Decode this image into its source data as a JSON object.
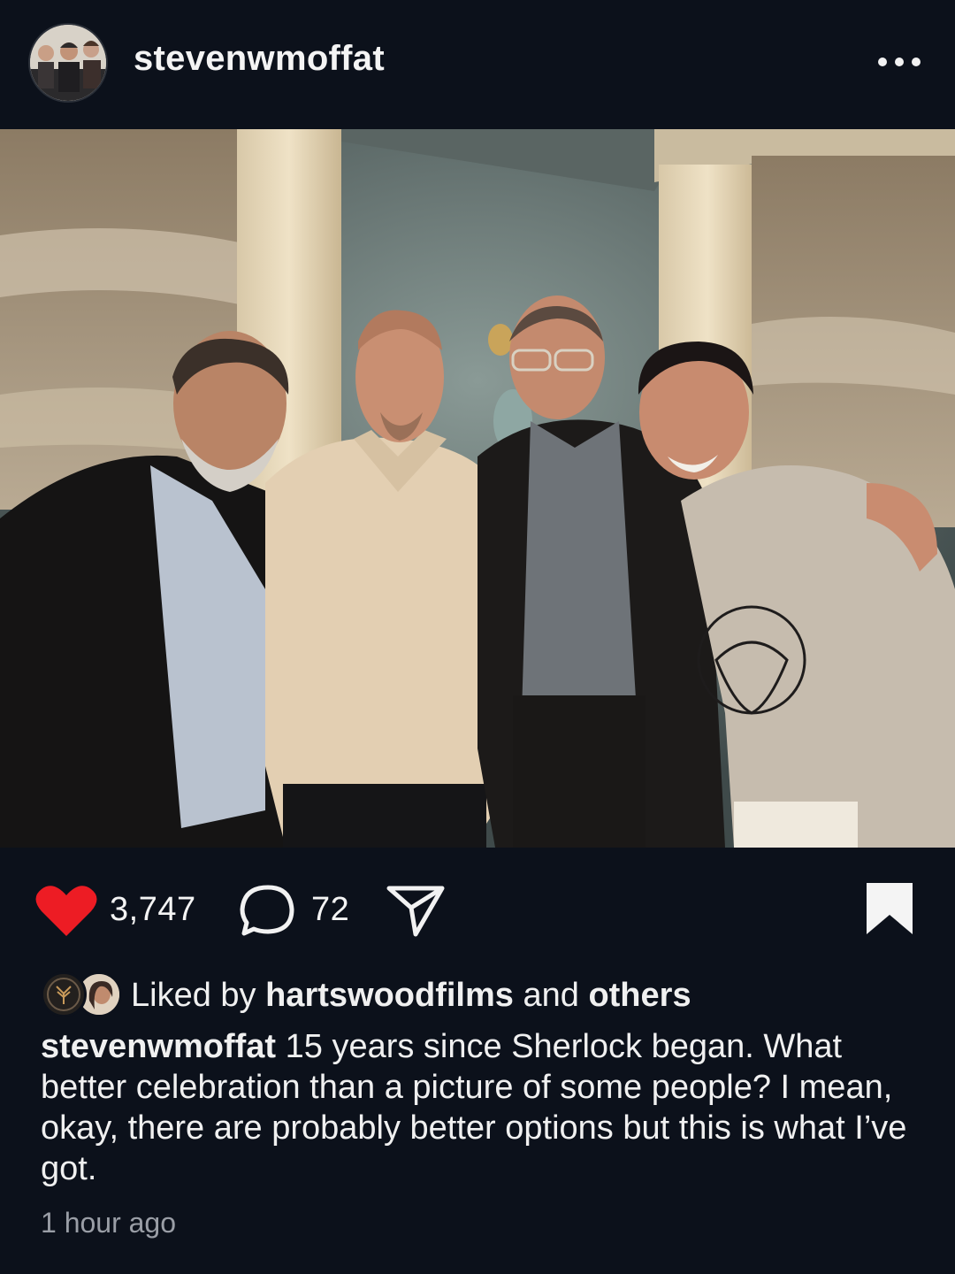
{
  "post": {
    "username": "stevenwmoffat",
    "more_icon": "more-dots-icon",
    "likes_count": "3,747",
    "comments_count": "72",
    "liked_by_prefix": "Liked by ",
    "liked_by_user": "hartswoodfilms",
    "liked_by_joiner": " and ",
    "liked_by_others": "others",
    "caption_user": "stevenwmoffat",
    "caption_text": " 15 years since Sherlock began. What better celebration than a picture of some people? I mean, okay, there are probably better options but this is what I’ve got.",
    "timestamp": "1 hour ago",
    "liked": true
  },
  "colors": {
    "background": "#0c111b",
    "heart": "#ed1c24",
    "text": "#f2f2f2",
    "muted": "#9a9ea6"
  }
}
